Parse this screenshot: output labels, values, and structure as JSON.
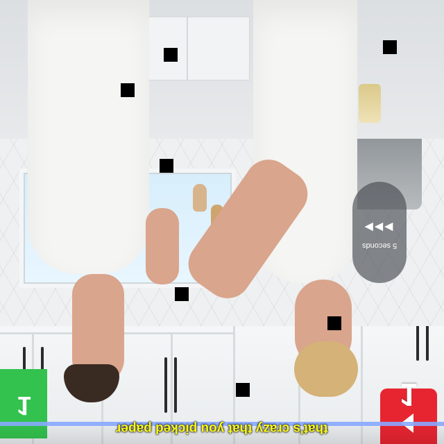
{
  "overlay": {
    "timer_label": "5 seconds",
    "timer_arrows": "◀◀◀",
    "left_tile_number": "1",
    "right_tile_number": "1",
    "caption": "that's crazy that you picked paper"
  },
  "colors": {
    "caption_yellow": "#f7f71e",
    "green_tile": "#33c24e",
    "red_tile": "#e72531",
    "progress_blue": "#88a9ff"
  }
}
